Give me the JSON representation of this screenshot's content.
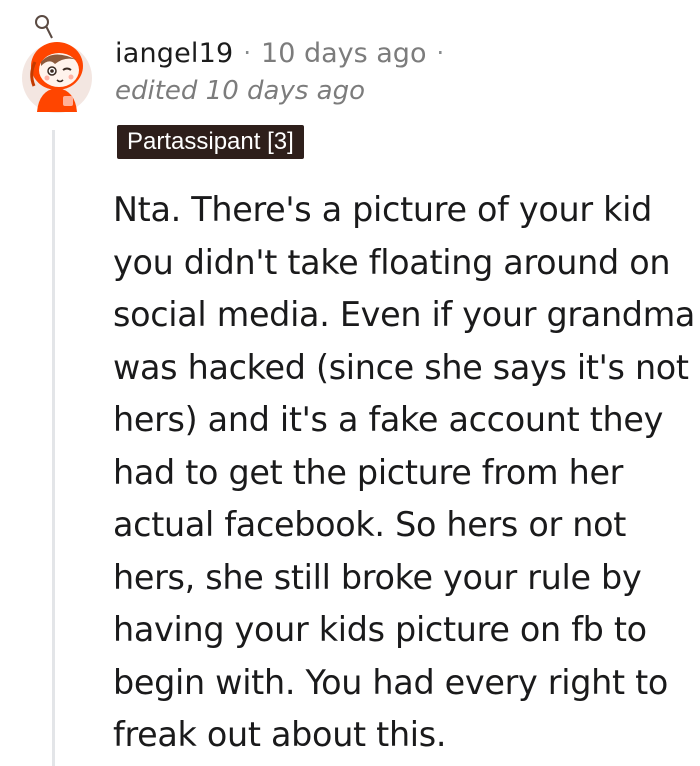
{
  "comment": {
    "author": "iangel19",
    "separator_1": "·",
    "timestamp": "10 days ago",
    "separator_2": "·",
    "edited_label": "edited 10 days ago",
    "flair": "Partassipant [3]",
    "body": "Nta. There's a picture of your kid you didn't take floating around on social media. Even if your grandma was hacked (since she says it's not hers) and it's a fake account they had to get the picture from her actual facebook. So hers or not hers, she still broke your rule by having your kids picture on fb to begin with. You had every right to freak out about this.",
    "avatar_icon": "snoo-avatar-icon"
  },
  "colors": {
    "flair_background": "#2e1f1b",
    "flair_text": "#ffffff",
    "username": "#1c1c1c",
    "muted": "#7c7c7c",
    "thread_line": "#e3e5e8",
    "avatar_accent": "#ff4500"
  }
}
